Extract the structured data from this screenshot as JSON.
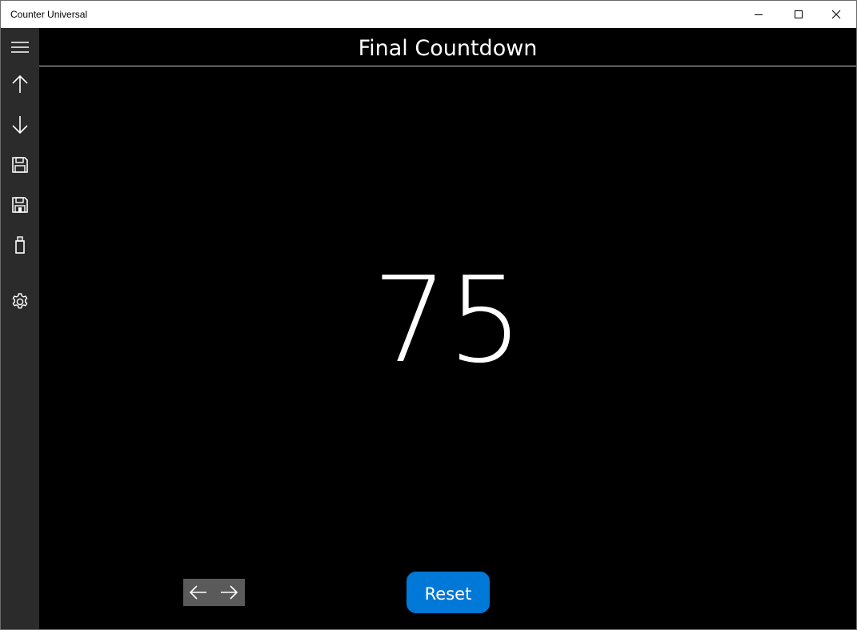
{
  "window": {
    "title": "Counter Universal"
  },
  "window_controls": {
    "minimize_icon": "minimize-icon",
    "maximize_icon": "maximize-icon",
    "close_icon": "close-icon"
  },
  "sidebar": {
    "items": [
      {
        "icon": "hamburger-menu-icon"
      },
      {
        "icon": "arrow-up-icon"
      },
      {
        "icon": "arrow-down-icon"
      },
      {
        "icon": "save-icon"
      },
      {
        "icon": "save-as-icon"
      },
      {
        "icon": "usb-drive-icon"
      },
      {
        "icon": "gear-icon"
      }
    ]
  },
  "main": {
    "title": "Final Countdown",
    "counter_value": "75",
    "reset_label": "Reset",
    "nav_arrows": {
      "prev_icon": "arrow-left-icon",
      "next_icon": "arrow-right-icon"
    }
  },
  "colors": {
    "background": "#000000",
    "sidebar": "#2b2b2b",
    "accent": "#0078d7",
    "arrow_group": "#5a5a5a",
    "text": "#ffffff"
  }
}
